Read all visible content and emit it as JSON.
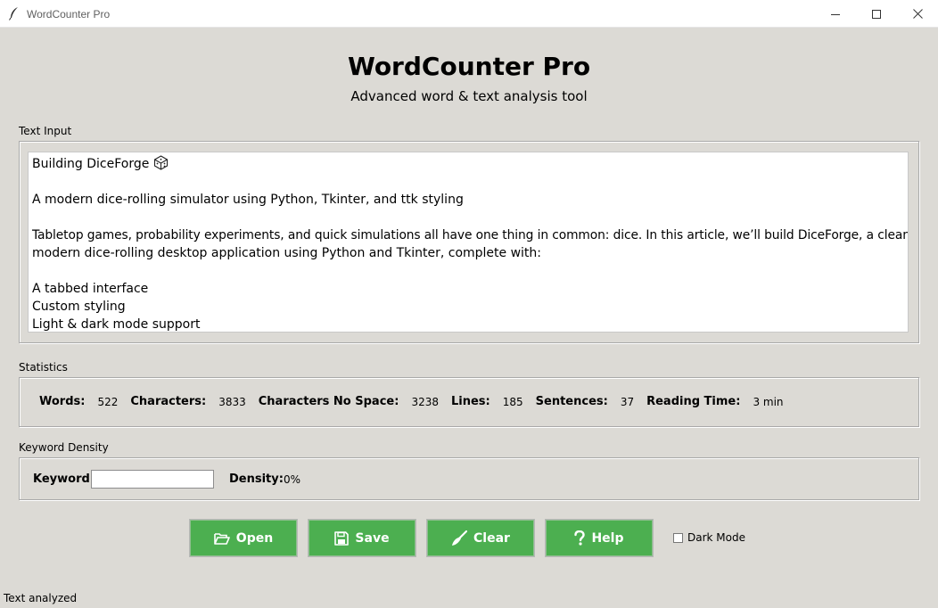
{
  "window": {
    "title": "WordCounter Pro",
    "controls": {
      "minimize": "—",
      "maximize": "☐",
      "close": "✕"
    }
  },
  "header": {
    "title": "WordCounter Pro",
    "subtitle": "Advanced word & text analysis tool"
  },
  "text_input": {
    "label": "Text Input",
    "lines": [
      "Building DiceForge",
      "",
      "A modern dice-rolling simulator using Python, Tkinter, and ttk styling",
      "",
      "Tabletop games, probability experiments, and quick simulations all have one thing in common: dice. In this article, we’ll build DiceForge, a clean and",
      "modern dice-rolling desktop application using Python and Tkinter, complete with:",
      "",
      "A tabbed interface",
      "Custom styling",
      "Light & dark mode support"
    ],
    "title_icon": "die-icon"
  },
  "statistics": {
    "label": "Statistics",
    "items": [
      {
        "label": "Words:",
        "value": "522"
      },
      {
        "label": "Characters:",
        "value": "3833"
      },
      {
        "label": "Characters No Space:",
        "value": "3238"
      },
      {
        "label": "Lines:",
        "value": "185"
      },
      {
        "label": "Sentences:",
        "value": "37"
      },
      {
        "label": "Reading Time:",
        "value": "3 min"
      }
    ]
  },
  "keyword_density": {
    "label": "Keyword Density",
    "keyword_label": "Keyword:",
    "keyword_value": "",
    "density_label": "Density:",
    "density_value": "0%"
  },
  "buttons": {
    "open": {
      "label": "Open",
      "icon": "folder-open-icon"
    },
    "save": {
      "label": "Save",
      "icon": "floppy-disk-icon"
    },
    "clear": {
      "label": "Clear",
      "icon": "broom-icon"
    },
    "help": {
      "label": "Help",
      "icon": "question-mark-icon"
    },
    "color": "#4caf50"
  },
  "dark_mode": {
    "label": "Dark Mode",
    "checked": false
  },
  "status_bar": {
    "text": "Text analyzed"
  }
}
